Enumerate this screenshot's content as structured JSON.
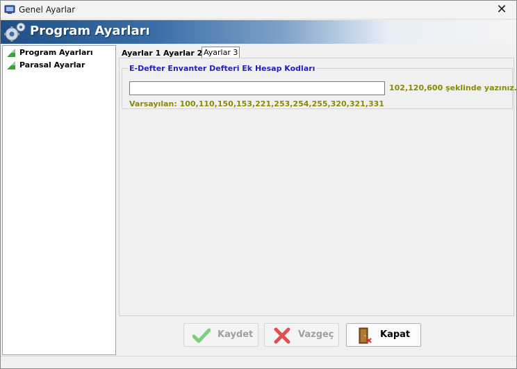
{
  "window": {
    "title": "Genel Ayarlar"
  },
  "banner": {
    "title": "Program Ayarları",
    "icon": "gears-icon"
  },
  "tree": {
    "items": [
      {
        "label": "Program Ayarları"
      },
      {
        "label": "Parasal Ayarlar"
      }
    ]
  },
  "tabs": [
    {
      "label": "Ayarlar 1",
      "active": false
    },
    {
      "label": "Ayarlar 2",
      "active": false
    },
    {
      "label": "Ayarlar 3",
      "active": true
    }
  ],
  "group": {
    "legend": "E-Defter Envanter Defteri Ek Hesap Kodları",
    "input_value": "",
    "hint": "102,120,600 şeklinde yazınız.",
    "default_text": "Varsayılan: 100,110,150,153,221,253,254,255,320,321,331"
  },
  "buttons": {
    "save": {
      "label": "Kaydet",
      "enabled": false
    },
    "cancel": {
      "label": "Vazgeç",
      "enabled": false
    },
    "close": {
      "label": "Kapat",
      "enabled": true
    }
  },
  "colors": {
    "legend": "#2020c0",
    "hint": "#8a8a00",
    "banner_start": "#1f4f86"
  }
}
